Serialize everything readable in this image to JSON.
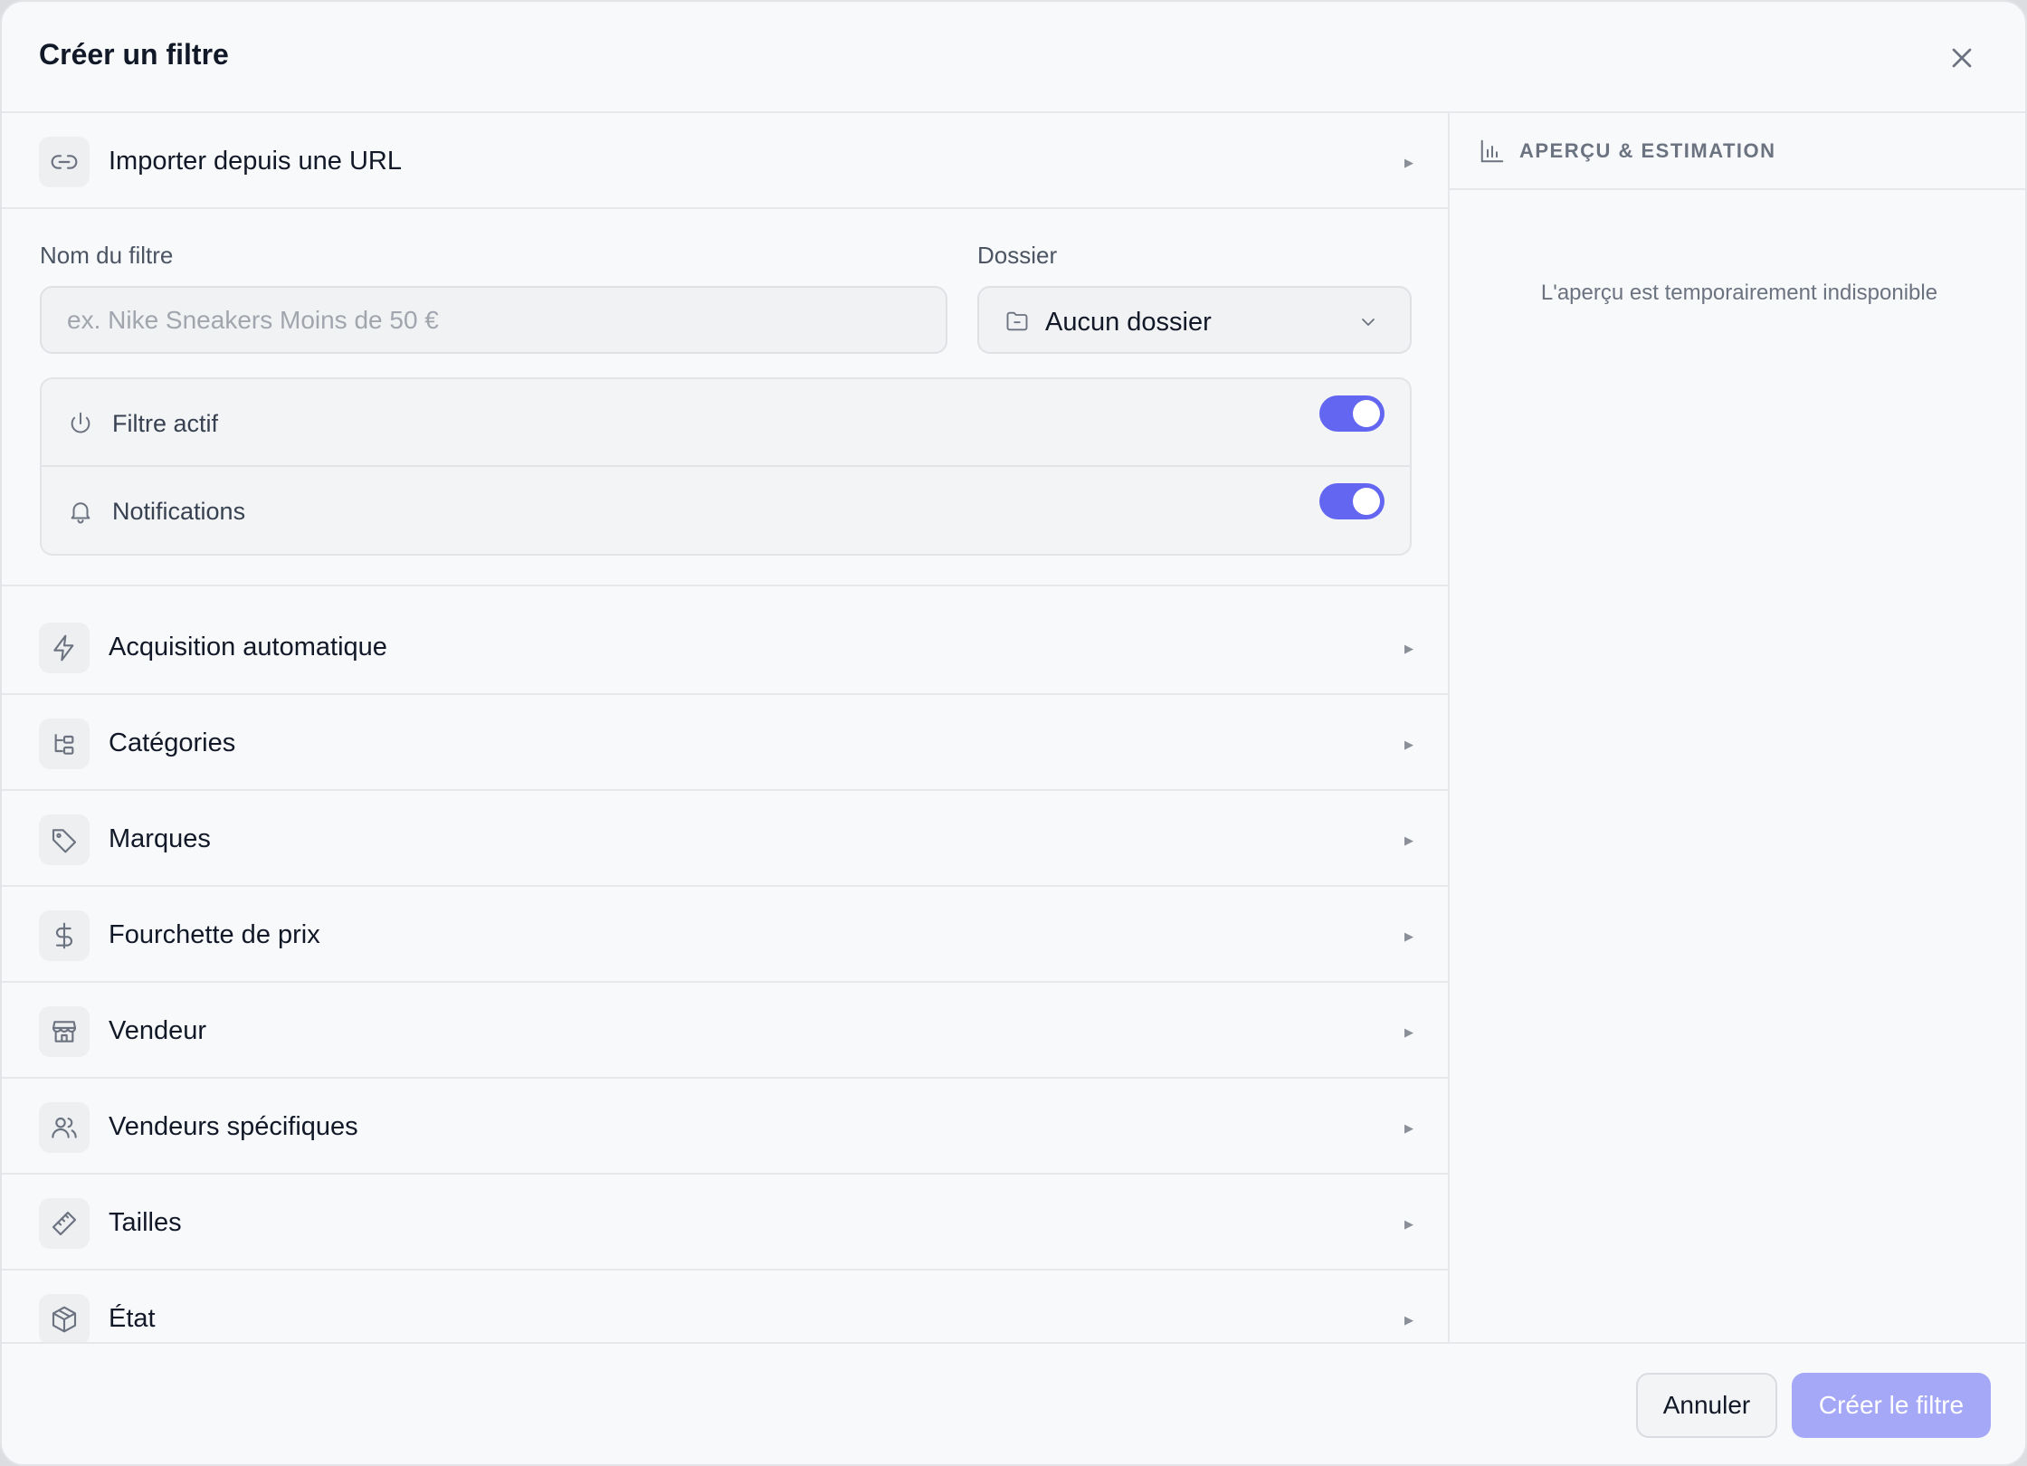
{
  "dialog": {
    "title": "Créer un filtre"
  },
  "import": {
    "label": "Importer depuis une URL"
  },
  "form": {
    "name_label": "Nom du filtre",
    "name_placeholder": "ex. Nike Sneakers Moins de 50 €",
    "name_value": "",
    "folder_label": "Dossier",
    "folder_value": "Aucun dossier"
  },
  "toggles": {
    "active": {
      "label": "Filtre actif",
      "on": true
    },
    "notifications": {
      "label": "Notifications",
      "on": true
    }
  },
  "sections": [
    {
      "label": "Acquisition automatique",
      "icon": "lightning-icon"
    },
    {
      "label": "Catégories",
      "icon": "category-tree-icon"
    },
    {
      "label": "Marques",
      "icon": "tag-icon"
    },
    {
      "label": "Fourchette de prix",
      "icon": "dollar-icon"
    },
    {
      "label": "Vendeur",
      "icon": "store-icon"
    },
    {
      "label": "Vendeurs spécifiques",
      "icon": "users-icon"
    },
    {
      "label": "Tailles",
      "icon": "ruler-icon"
    },
    {
      "label": "État",
      "icon": "box-icon"
    }
  ],
  "preview": {
    "title": "APERÇU & ESTIMATION",
    "message": "L'aperçu est temporairement indisponible"
  },
  "footer": {
    "cancel_label": "Annuler",
    "create_label": "Créer le filtre"
  },
  "colors": {
    "accent": "#6366f1",
    "accent_disabled": "#a5a8f6"
  }
}
